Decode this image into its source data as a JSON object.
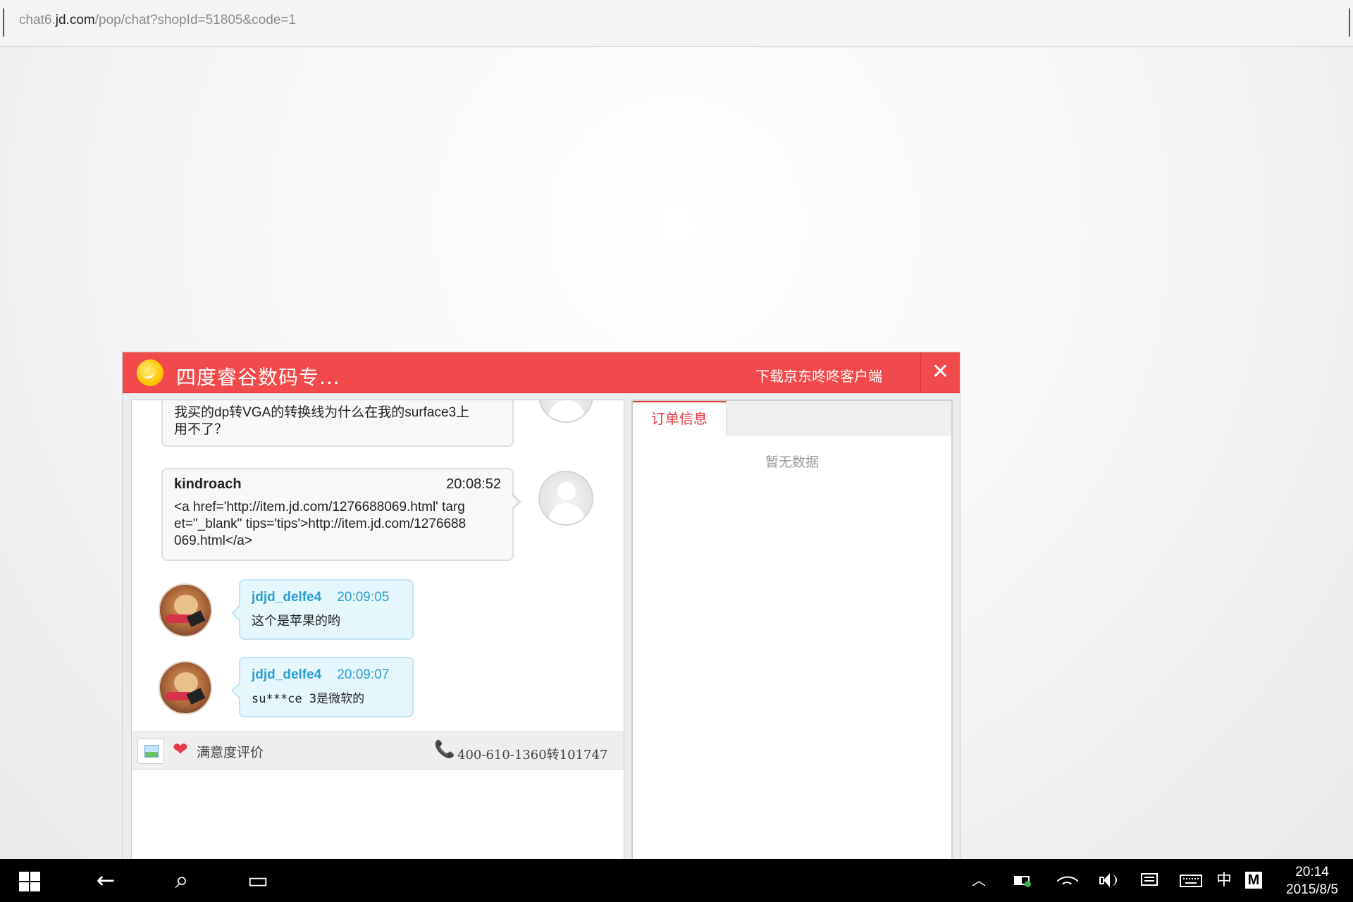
{
  "address_bar": {
    "url_prefix": "chat6.",
    "url_host": "jd.com",
    "url_path": "/pop/chat?shopId=51805&code=1"
  },
  "window": {
    "title": "四度睿谷数码专...",
    "download_link": "下载京东咚咚客户端",
    "close_symbol": "✕",
    "accent_color": "#f24a4a"
  },
  "messages": [
    {
      "side": "right",
      "user": "",
      "time": "",
      "text_line1": "我买的dp转VGA的转换线为什么在我的surface3上",
      "text_line2": "用不了？"
    },
    {
      "side": "right",
      "user": "kindroach",
      "time": "20:08:52",
      "text_line1": "<a href='http://item.jd.com/1276688069.html' targ",
      "text_line2": "et=\"_blank\" tips='tips'>http://item.jd.com/1276688",
      "text_line3": "069.html</a>"
    },
    {
      "side": "left",
      "user": "jdjd_delfe4",
      "time": "20:09:05",
      "text": "这个是苹果的哟"
    },
    {
      "side": "left",
      "user": "jdjd_delfe4",
      "time": "20:09:07",
      "text": "su***ce 3是微软的"
    }
  ],
  "toolbar": {
    "rating_label": "满意度评价",
    "phone": "400-610-1360转101747",
    "heart_symbol": "❤",
    "phone_symbol": "📞"
  },
  "info_panel": {
    "tab_label": "订单信息",
    "empty_text": "暂无数据"
  },
  "taskbar": {
    "back_symbol": "←",
    "search_symbol": "⌕",
    "taskview_symbol": "▭",
    "chevron_symbol": "︿",
    "ime_label": "中",
    "m_label": "M",
    "clock_time": "20:14",
    "clock_date": "2015/8/5"
  }
}
